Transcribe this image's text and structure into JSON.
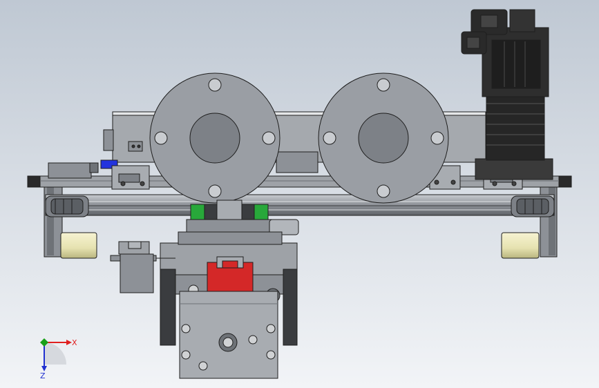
{
  "viewport": {
    "background_top": "#bfc8d3",
    "background_bottom": "#f2f4f7"
  },
  "colors": {
    "metal_light": "#9a9ea4",
    "metal_mid": "#7d8187",
    "metal_dark": "#5b5f64",
    "edge": "#1e1e1e",
    "bearing_block": "#28a83a",
    "slider_red": "#d42828",
    "motor_black": "#262626",
    "roller_cream": "#e6e2b0",
    "blue_part": "#2233dd",
    "axis_x": "#e02020",
    "axis_y": "#18a018",
    "axis_z": "#2030d0"
  },
  "triad": {
    "x_label": "X",
    "z_label": "Z"
  }
}
